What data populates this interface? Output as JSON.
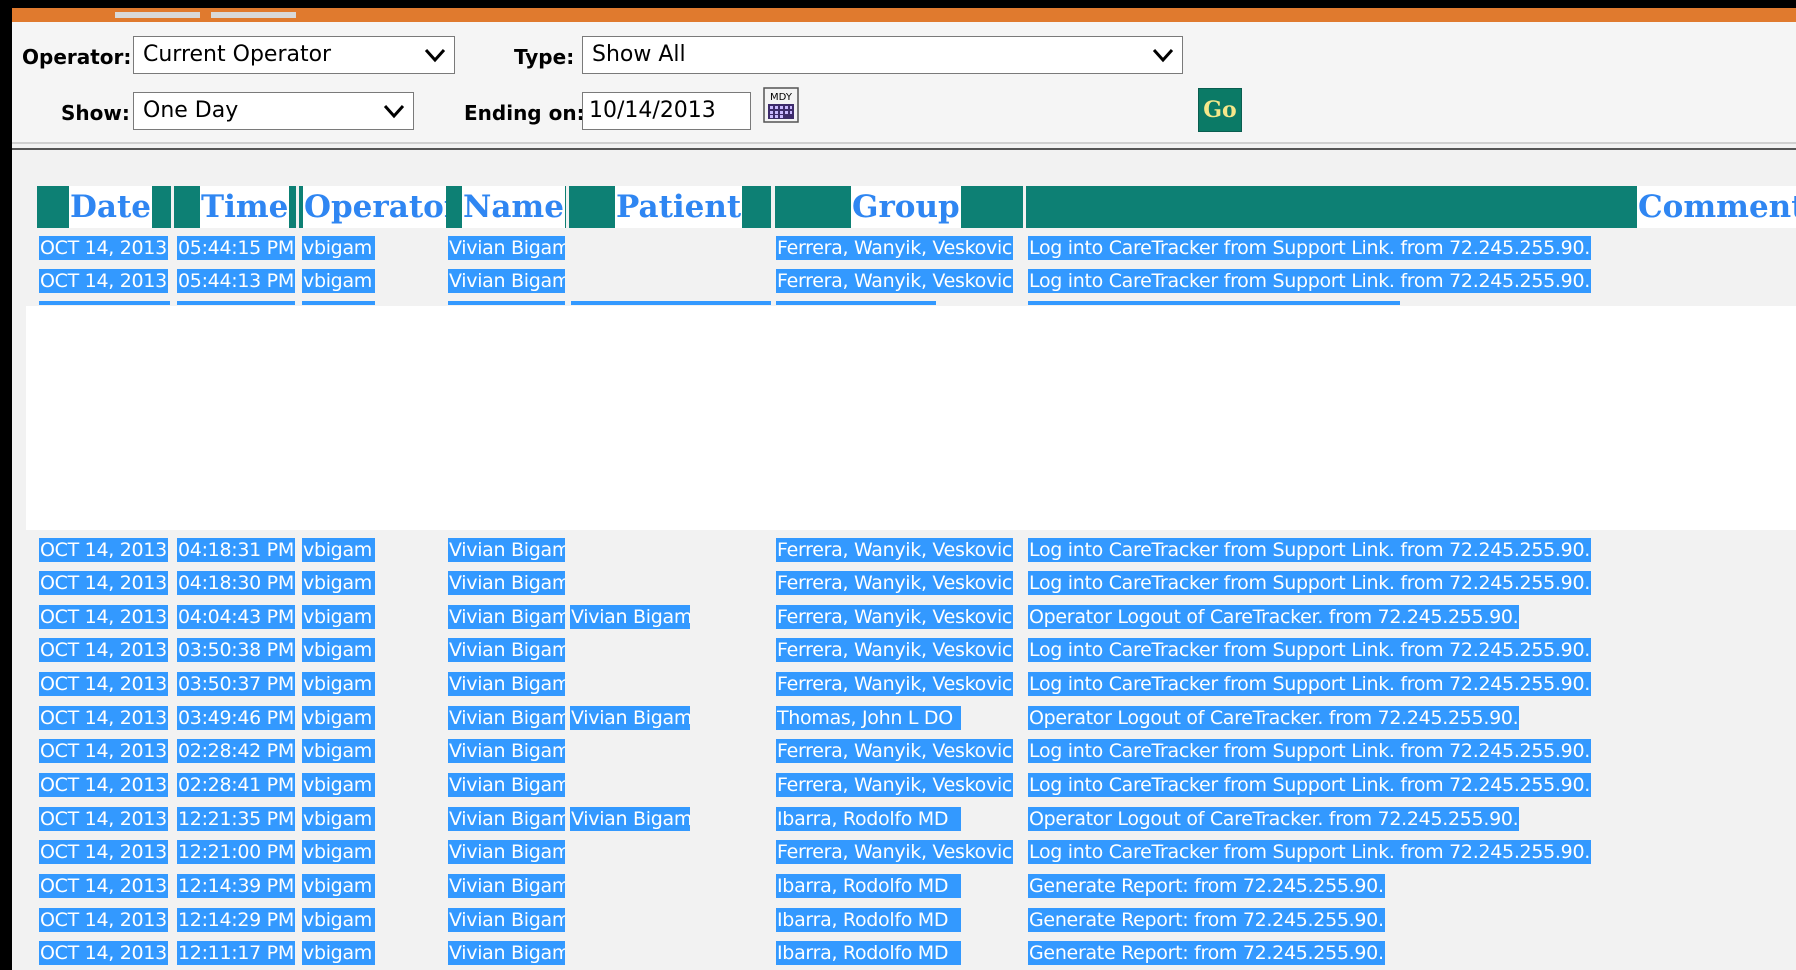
{
  "filters": {
    "operator_label": "Operator:",
    "operator_value": "Current Operator",
    "type_label": "Type:",
    "type_value": "Show All",
    "show_label": "Show:",
    "show_value": "One Day",
    "ending_label": "Ending on:",
    "ending_value": "10/14/2013",
    "calendar_caption": "MDY",
    "go_label": "Go"
  },
  "table": {
    "headers": {
      "date": "Date",
      "time": "Time",
      "operator": "Operator",
      "name": "Name",
      "patient": "Patient",
      "group": "Group",
      "comment": "Comment"
    },
    "rows": [
      {
        "date": "OCT 14, 2013",
        "time": "05:44:15 PM",
        "operator": "vbigam",
        "name": "Vivian Bigam",
        "patient": "",
        "group": "Ferrera, Wanyik, Veskovic",
        "comment": "Log into CareTracker from Support Link. from 72.245.255.90."
      },
      {
        "date": "OCT 14, 2013",
        "time": "05:44:13 PM",
        "operator": "vbigam",
        "name": "Vivian Bigam",
        "patient": "",
        "group": "Ferrera, Wanyik, Veskovic",
        "comment": "Log into CareTracker from Support Link. from 72.245.255.90."
      },
      {
        "date": "OCT 14, 2013",
        "time": "04:18:31 PM",
        "operator": "vbigam",
        "name": "Vivian Bigam",
        "patient": "",
        "group": "Ferrera, Wanyik, Veskovic",
        "comment": "Log into CareTracker from Support Link. from 72.245.255.90."
      },
      {
        "date": "OCT 14, 2013",
        "time": "04:18:30 PM",
        "operator": "vbigam",
        "name": "Vivian Bigam",
        "patient": "",
        "group": "Ferrera, Wanyik, Veskovic",
        "comment": "Log into CareTracker from Support Link. from 72.245.255.90."
      },
      {
        "date": "OCT 14, 2013",
        "time": "04:04:43 PM",
        "operator": "vbigam",
        "name": "Vivian Bigam",
        "patient": "Vivian Bigam",
        "group": "Ferrera, Wanyik, Veskovic",
        "comment": "Operator Logout of CareTracker. from 72.245.255.90."
      },
      {
        "date": "OCT 14, 2013",
        "time": "03:50:38 PM",
        "operator": "vbigam",
        "name": "Vivian Bigam",
        "patient": "",
        "group": "Ferrera, Wanyik, Veskovic",
        "comment": "Log into CareTracker from Support Link. from 72.245.255.90."
      },
      {
        "date": "OCT 14, 2013",
        "time": "03:50:37 PM",
        "operator": "vbigam",
        "name": "Vivian Bigam",
        "patient": "",
        "group": "Ferrera, Wanyik, Veskovic",
        "comment": "Log into CareTracker from Support Link. from 72.245.255.90."
      },
      {
        "date": "OCT 14, 2013",
        "time": "03:49:46 PM",
        "operator": "vbigam",
        "name": "Vivian Bigam",
        "patient": "Vivian Bigam",
        "group": "Thomas, John L DO",
        "comment": "Operator Logout of CareTracker. from 72.245.255.90."
      },
      {
        "date": "OCT 14, 2013",
        "time": "02:28:42 PM",
        "operator": "vbigam",
        "name": "Vivian Bigam",
        "patient": "",
        "group": "Ferrera, Wanyik, Veskovic",
        "comment": "Log into CareTracker from Support Link. from 72.245.255.90."
      },
      {
        "date": "OCT 14, 2013",
        "time": "02:28:41 PM",
        "operator": "vbigam",
        "name": "Vivian Bigam",
        "patient": "",
        "group": "Ferrera, Wanyik, Veskovic",
        "comment": "Log into CareTracker from Support Link. from 72.245.255.90."
      },
      {
        "date": "OCT 14, 2013",
        "time": "12:21:35 PM",
        "operator": "vbigam",
        "name": "Vivian Bigam",
        "patient": "Vivian Bigam",
        "group": "Ibarra, Rodolfo MD",
        "comment": "Operator Logout of CareTracker. from 72.245.255.90."
      },
      {
        "date": "OCT 14, 2013",
        "time": "12:21:00 PM",
        "operator": "vbigam",
        "name": "Vivian Bigam",
        "patient": "",
        "group": "Ferrera, Wanyik, Veskovic",
        "comment": "Log into CareTracker from Support Link. from 72.245.255.90."
      },
      {
        "date": "OCT 14, 2013",
        "time": "12:14:39 PM",
        "operator": "vbigam",
        "name": "Vivian Bigam",
        "patient": "",
        "group": "Ibarra, Rodolfo MD",
        "comment": "Generate Report: from 72.245.255.90."
      },
      {
        "date": "OCT 14, 2013",
        "time": "12:14:29 PM",
        "operator": "vbigam",
        "name": "Vivian Bigam",
        "patient": "",
        "group": "Ibarra, Rodolfo MD",
        "comment": "Generate Report: from 72.245.255.90."
      },
      {
        "date": "OCT 14, 2013",
        "time": "12:11:17 PM",
        "operator": "vbigam",
        "name": "Vivian Bigam",
        "patient": "",
        "group": "Ibarra, Rodolfo MD",
        "comment": "Generate Report: from 72.245.255.90."
      }
    ]
  },
  "colors": {
    "header_bg": "#0d8074",
    "header_text": "#2f86f2",
    "selection_bg": "#3399ff",
    "selection_text": "#ffffff",
    "go_button": "#0b7a66",
    "top_accent": "#e07a2e"
  },
  "icons": {
    "dropdown": "chevron-down-icon",
    "calendar": "calendar-icon"
  }
}
